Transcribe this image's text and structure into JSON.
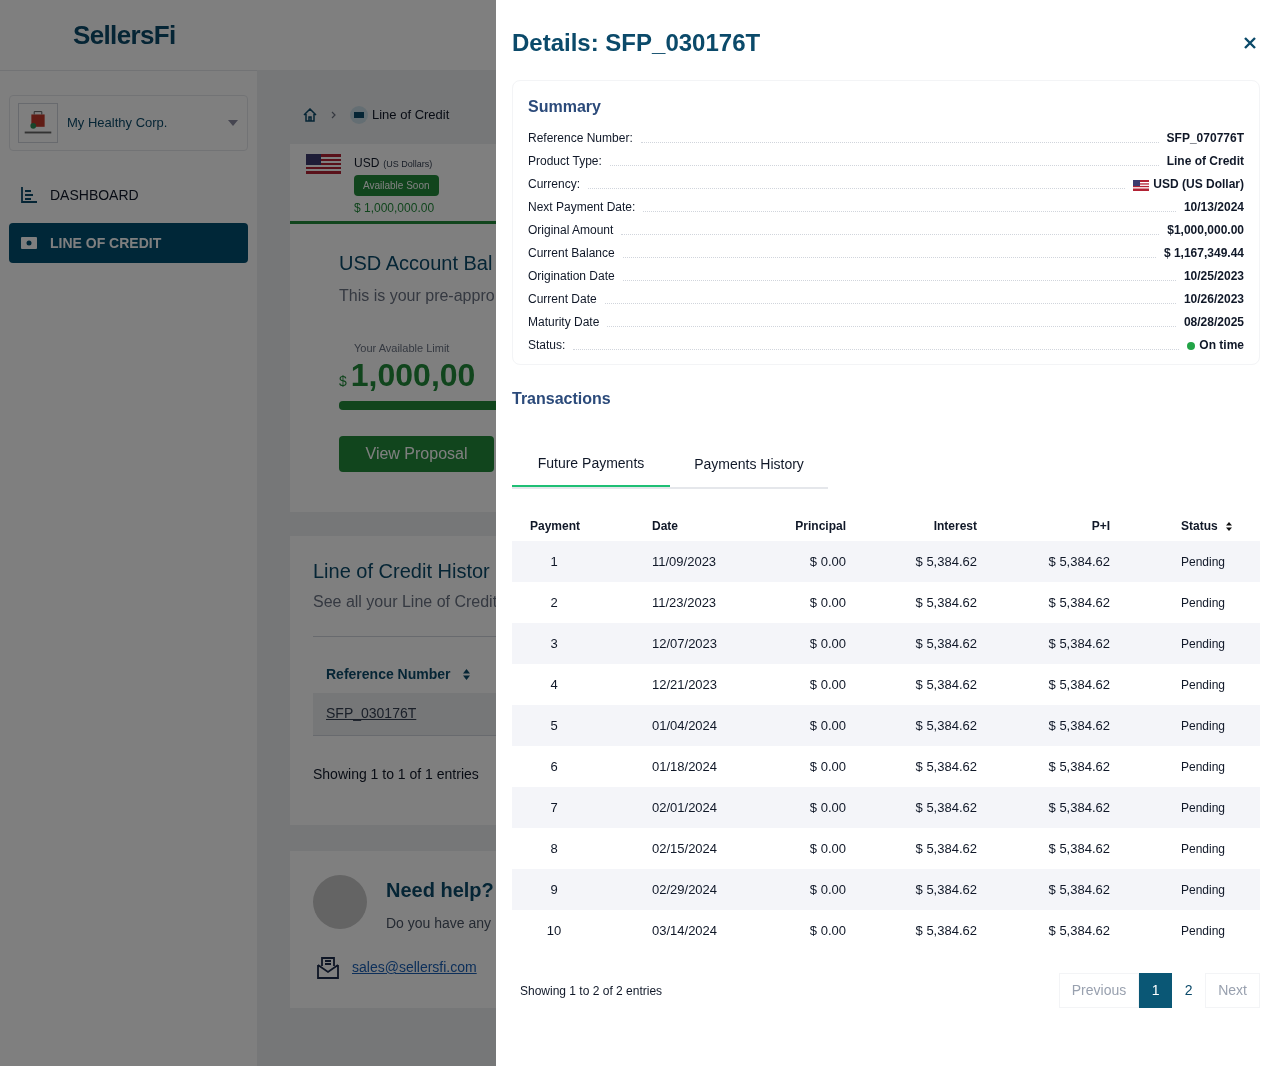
{
  "logo": {
    "text": "SellersFi"
  },
  "sidebar": {
    "company": "My Healthy Corp.",
    "items": [
      {
        "label": "DASHBOARD",
        "kind": "dashboard",
        "selected": false
      },
      {
        "label": "LINE OF CREDIT",
        "kind": "credit",
        "selected": true
      }
    ]
  },
  "breadcrumb": {
    "current": "Line of Credit"
  },
  "currency_card": {
    "code": "USD",
    "name": "(US Dollars)",
    "badge": "Available Soon",
    "amount": "$ 1,000,000.00"
  },
  "balance": {
    "title": "USD Account Bal",
    "subtitle": "This is your pre-appro",
    "limit_label": "Your Available Limit",
    "currency_sign": "$",
    "limit": "1,000,00",
    "level": 1,
    "button": "View Proposal"
  },
  "history": {
    "title": "Line of Credit Histor",
    "subtitle": "See all your Line of Credit",
    "column": "Reference Number",
    "rows": [
      "SFP_030176T"
    ],
    "footer": "Showing 1 to 1 of 1 entries"
  },
  "help": {
    "title": "Need help?",
    "text": "Do you have any",
    "email": "sales@sellersfi.com"
  },
  "details": {
    "title": "Details: SFP_030176T",
    "summary": {
      "title": "Summary",
      "rows": [
        {
          "label": "Reference Number:",
          "value": "SFP_070776T",
          "kind": "text"
        },
        {
          "label": "Product Type:",
          "value": "Line of Credit",
          "kind": "text"
        },
        {
          "label": "Currency:",
          "value": "USD (US Dollar)",
          "kind": "currency"
        },
        {
          "label": "Next Payment Date:",
          "value": "10/13/2024",
          "kind": "text"
        },
        {
          "label": "Original Amount",
          "value": "$1,000,000.00",
          "kind": "text"
        },
        {
          "label": "Current Balance",
          "value": "$ 1,167,349.44",
          "kind": "text"
        },
        {
          "label": "Origination Date",
          "value": "10/25/2023",
          "kind": "text"
        },
        {
          "label": "Current Date",
          "value": "10/26/2023",
          "kind": "text"
        },
        {
          "label": "Maturity Date",
          "value": "08/28/2025",
          "kind": "text"
        },
        {
          "label": "Status:",
          "value": "On time",
          "kind": "status",
          "color": "#22a447"
        }
      ]
    },
    "transactions_title": "Transactions",
    "tabs": [
      {
        "label": "Future Payments",
        "selected": true
      },
      {
        "label": "Payments History",
        "selected": false
      }
    ],
    "columns": [
      "Payment",
      "Date",
      "Principal",
      "Interest",
      "P+I",
      "Status"
    ],
    "rows": [
      [
        "1",
        "11/09/2023",
        "$ 0.00",
        "$ 5,384.62",
        "$ 5,384.62",
        "Pending"
      ],
      [
        "2",
        "11/23/2023",
        "$ 0.00",
        "$ 5,384.62",
        "$ 5,384.62",
        "Pending"
      ],
      [
        "3",
        "12/07/2023",
        "$ 0.00",
        "$ 5,384.62",
        "$ 5,384.62",
        "Pending"
      ],
      [
        "4",
        "12/21/2023",
        "$ 0.00",
        "$ 5,384.62",
        "$ 5,384.62",
        "Pending"
      ],
      [
        "5",
        "01/04/2024",
        "$ 0.00",
        "$ 5,384.62",
        "$ 5,384.62",
        "Pending"
      ],
      [
        "6",
        "01/18/2024",
        "$ 0.00",
        "$ 5,384.62",
        "$ 5,384.62",
        "Pending"
      ],
      [
        "7",
        "02/01/2024",
        "$ 0.00",
        "$ 5,384.62",
        "$ 5,384.62",
        "Pending"
      ],
      [
        "8",
        "02/15/2024",
        "$ 0.00",
        "$ 5,384.62",
        "$ 5,384.62",
        "Pending"
      ],
      [
        "9",
        "02/29/2024",
        "$ 0.00",
        "$ 5,384.62",
        "$ 5,384.62",
        "Pending"
      ],
      [
        "10",
        "03/14/2024",
        "$ 0.00",
        "$ 5,384.62",
        "$ 5,384.62",
        "Pending"
      ]
    ],
    "footer": "Showing 1 to 2 of 2 entries",
    "pagination": [
      {
        "label": "Previous",
        "kind": "nav",
        "disabled": true
      },
      {
        "label": "1",
        "kind": "page",
        "selected": true
      },
      {
        "label": "2",
        "kind": "page",
        "selected": false
      },
      {
        "label": "Next",
        "kind": "nav",
        "disabled": true
      }
    ]
  }
}
